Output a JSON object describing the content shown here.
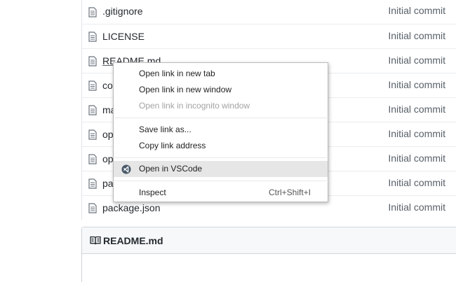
{
  "files": [
    {
      "name": ".gitignore",
      "commit": "Initial commit"
    },
    {
      "name": "LICENSE",
      "commit": "Initial commit"
    },
    {
      "name": "README.md",
      "commit": "Initial commit"
    },
    {
      "name": "co",
      "commit": "Initial commit"
    },
    {
      "name": "ma",
      "commit": "Initial commit"
    },
    {
      "name": "op",
      "commit": "Initial commit"
    },
    {
      "name": "op",
      "commit": "Initial commit"
    },
    {
      "name": "pa",
      "commit": "Initial commit"
    },
    {
      "name": "package.json",
      "commit": "Initial commit"
    }
  ],
  "readme": {
    "title": "README.md"
  },
  "context_menu": {
    "items": [
      {
        "label": "Open link in new tab"
      },
      {
        "label": "Open link in new window"
      },
      {
        "label": "Open link in incognito window"
      },
      {
        "label": "Save link as..."
      },
      {
        "label": "Copy link address"
      },
      {
        "label": "Open in VSCode"
      },
      {
        "label": "Inspect",
        "shortcut": "Ctrl+Shift+I"
      }
    ]
  },
  "colors": {
    "vscode_icon": "#4a5a6a",
    "highlight": "#e6e6e6"
  }
}
